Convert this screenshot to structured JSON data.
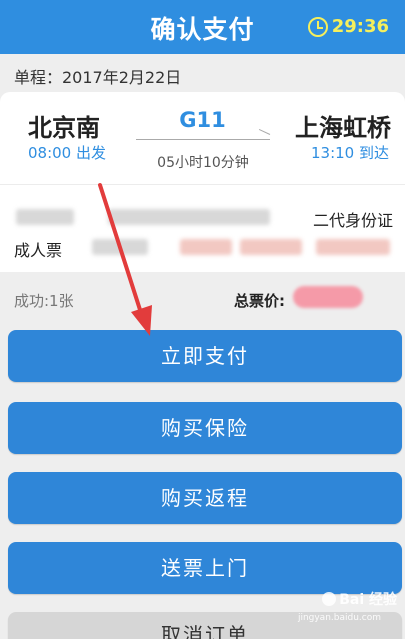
{
  "header": {
    "title": "确认支付",
    "countdown": "29:36"
  },
  "trip": {
    "date_line": "单程：2017年2月22日",
    "from_station": "北京南",
    "to_station": "上海虹桥",
    "train_no": "G11",
    "depart": "08:00 出发",
    "arrive": "13:10 到达",
    "duration": "05小时10分钟"
  },
  "passenger": {
    "id_type": "二代身份证",
    "ticket_type": "成人票"
  },
  "summary": {
    "count": "成功:1张",
    "total_label": "总票价:"
  },
  "actions": {
    "pay": "立即支付",
    "insurance": "购买保险",
    "return_trip": "购买返程",
    "delivery": "送票上门",
    "cancel": "取消订单"
  },
  "watermark": {
    "brand": "Bai  经验",
    "url": "jingyan.baidu.com"
  },
  "colors": {
    "primary": "#2f86d8",
    "header": "#2f8ee0",
    "timer": "#f5ef5c",
    "arrow": "#e23c3c"
  },
  "icons": {
    "timer": "clock-icon"
  }
}
